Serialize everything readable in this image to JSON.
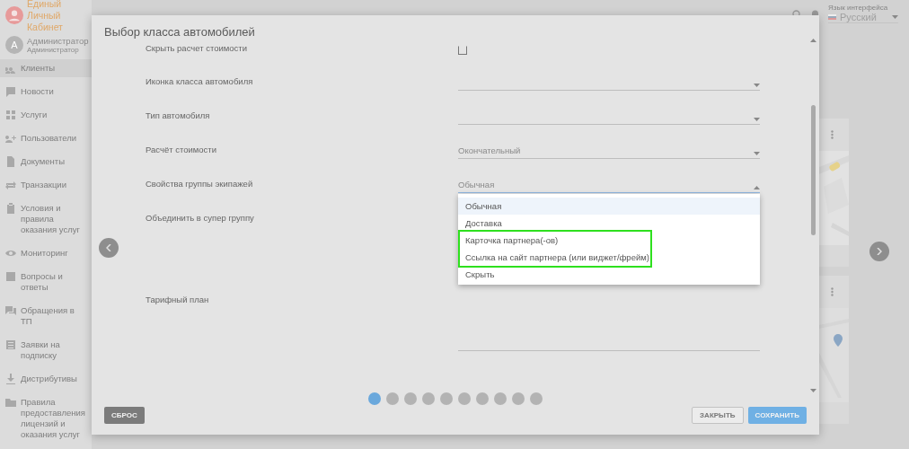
{
  "brand": {
    "title": "Единый Личный Кабинет"
  },
  "user": {
    "initial": "A",
    "name": "Администратор",
    "role": "Администратор"
  },
  "sidebar": {
    "items": [
      {
        "label": "Клиенты",
        "selected": true
      },
      {
        "label": "Новости",
        "selected": false
      },
      {
        "label": "Услуги",
        "selected": false
      },
      {
        "label": "Пользователи",
        "selected": false
      },
      {
        "label": "Документы",
        "selected": false
      },
      {
        "label": "Транзакции",
        "selected": false
      },
      {
        "label": "Условия и правила оказания услуг",
        "selected": false
      },
      {
        "label": "Мониторинг",
        "selected": false
      },
      {
        "label": "Вопросы и ответы",
        "selected": false
      },
      {
        "label": "Обращения в ТП",
        "selected": false
      },
      {
        "label": "Заявки на подписку",
        "selected": false
      },
      {
        "label": "Дистрибутивы",
        "selected": false
      },
      {
        "label": "Правила предоставления лицензий и оказания услуг",
        "selected": false
      }
    ]
  },
  "language": {
    "label": "Язык интерфейса",
    "value": "Русский"
  },
  "dialog": {
    "title": "Выбор класса автомобилей",
    "rows": [
      {
        "kind": "checkbox",
        "label": "Скрыть расчет стоимости",
        "checked": false
      },
      {
        "kind": "select",
        "label": "Иконка класса автомобиля",
        "expanded": false
      },
      {
        "kind": "select",
        "label": "Тип автомобиля",
        "expanded": false
      },
      {
        "kind": "select",
        "label": "Расчёт стоимости",
        "value": "Окончательный",
        "expanded": false
      },
      {
        "kind": "select",
        "label": "Свойства группы экипажей",
        "value": "Обычная",
        "expanded": true,
        "options": [
          {
            "label": "Обычная",
            "selected": true
          },
          {
            "label": "Доставка",
            "selected": false
          },
          {
            "label": "Карточка партнера(-ов)",
            "selected": false
          },
          {
            "label": "Ссылка на сайт партнера (или виджет/фрейм)",
            "selected": false
          },
          {
            "label": "Скрыть",
            "selected": false
          }
        ]
      },
      {
        "kind": "label",
        "label": "Объединить в супер группу"
      },
      {
        "kind": "field",
        "label": "Тарифный план"
      }
    ],
    "pages": [
      {
        "selected": true
      },
      {
        "selected": false
      },
      {
        "selected": false
      },
      {
        "selected": false
      },
      {
        "selected": false
      },
      {
        "selected": false
      },
      {
        "selected": false
      },
      {
        "selected": false
      },
      {
        "selected": false
      },
      {
        "selected": false
      }
    ],
    "buttons": {
      "reset": "СБРОС",
      "close": "ЗАКРЫТЬ",
      "save": "СОХРАНИТЬ"
    }
  }
}
